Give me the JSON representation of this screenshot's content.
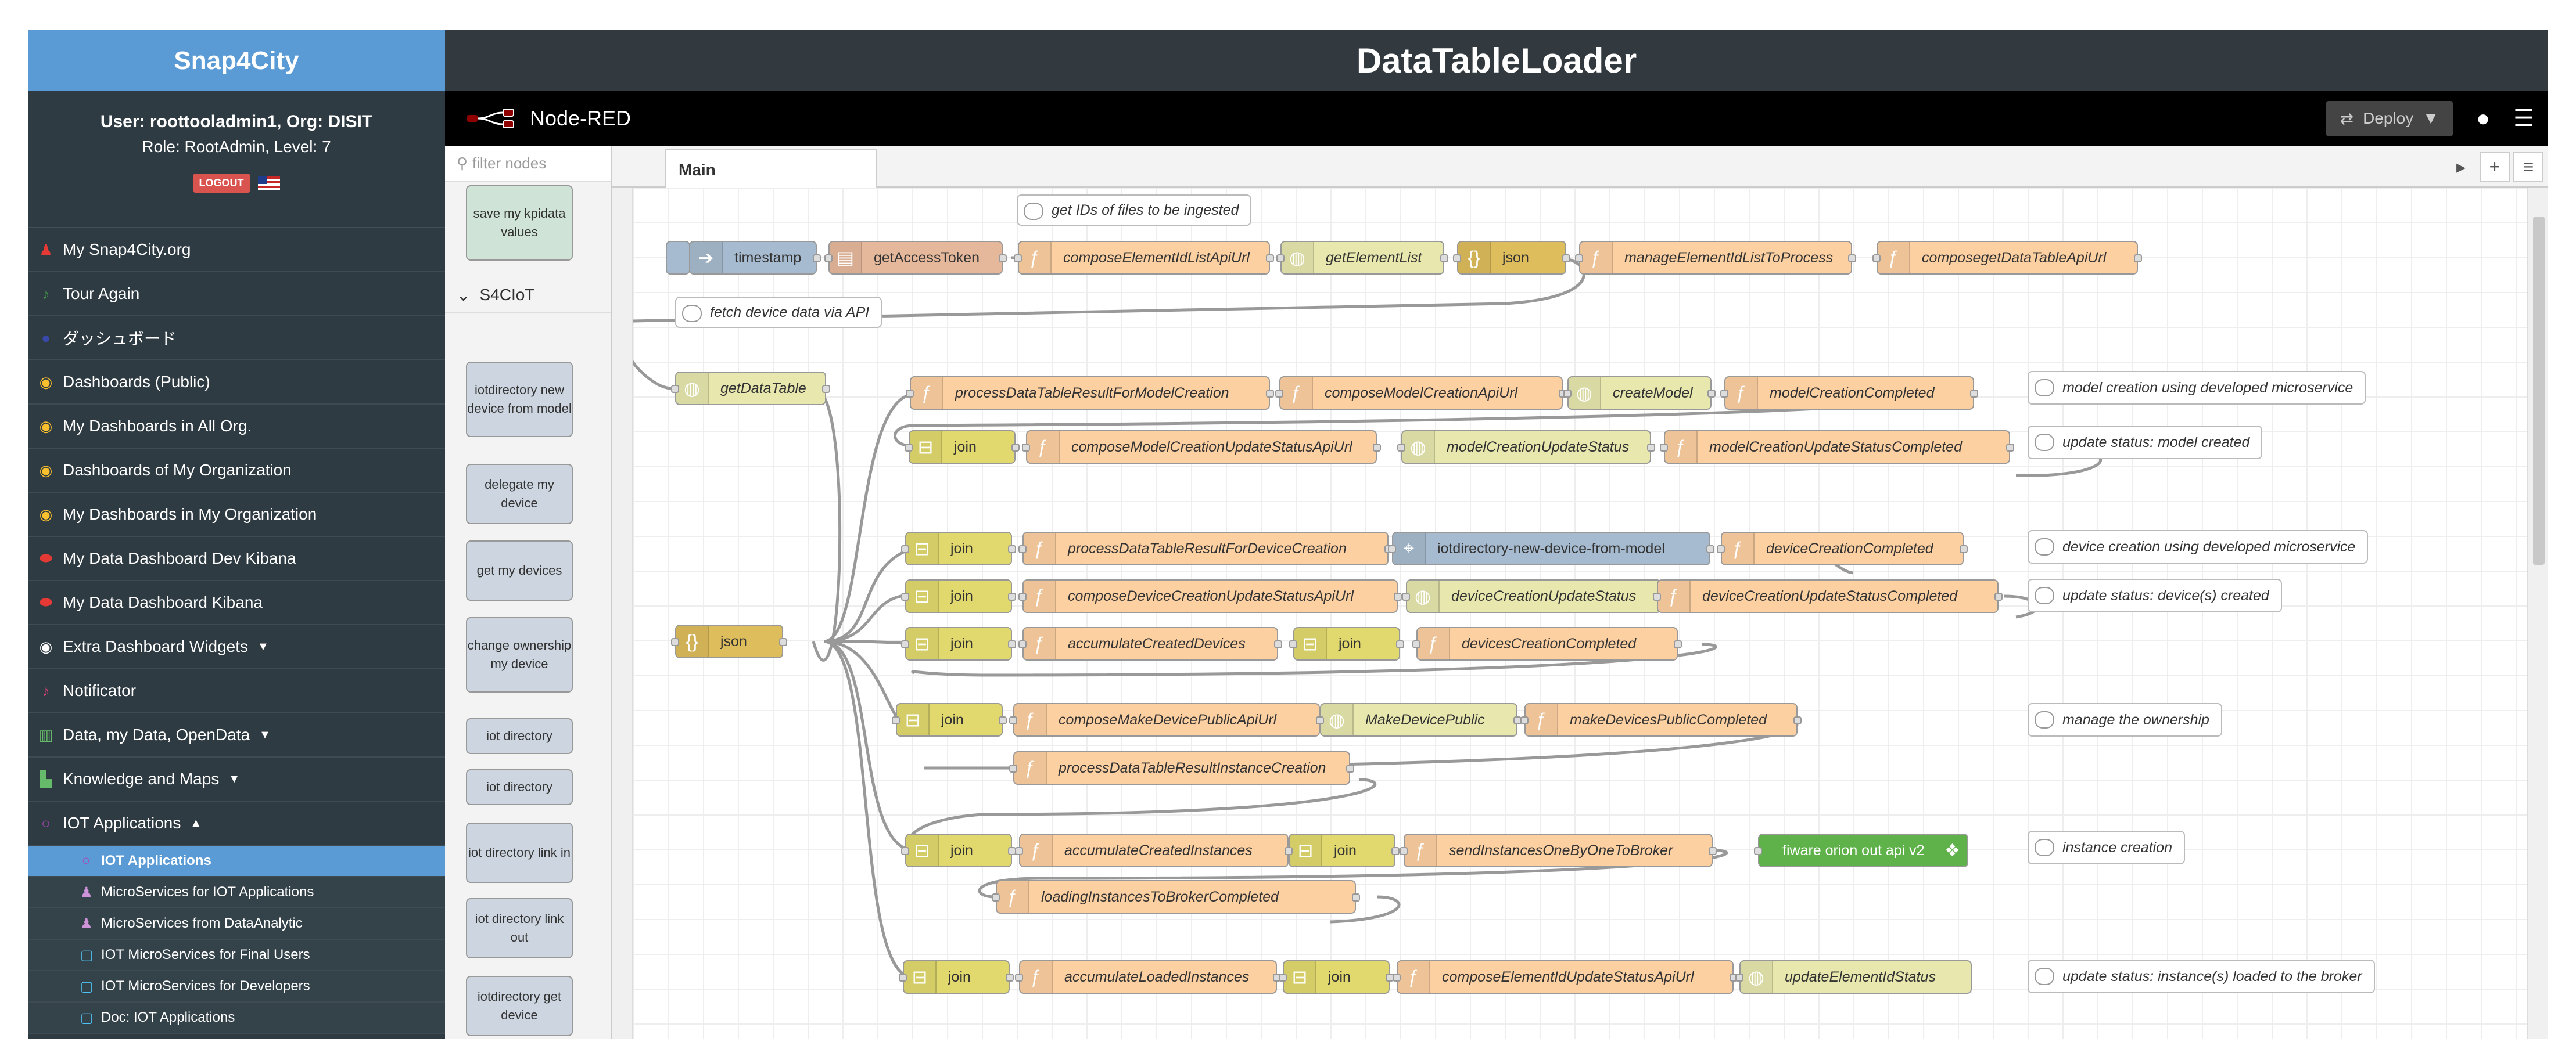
{
  "snap4city": {
    "title": "Snap4City",
    "user_line": "User: roottooladmin1, Org: DISIT",
    "role_line": "Role: RootAdmin, Level: 7",
    "logout_label": "LOGOUT",
    "menu": [
      {
        "label": "My Snap4City.org",
        "icon": "user-icon",
        "color": "#e53935"
      },
      {
        "label": "Tour Again",
        "icon": "bell-icon",
        "color": "#43a047"
      },
      {
        "label": "ダッシュボード",
        "icon": "circle-icon",
        "color": "#3949ab"
      },
      {
        "label": "Dashboards (Public)",
        "icon": "dashboard-icon",
        "color": "#fbc02d"
      },
      {
        "label": "My Dashboards in All Org.",
        "icon": "dashboard-icon",
        "color": "#fbc02d"
      },
      {
        "label": "Dashboards of My Organization",
        "icon": "dashboard-icon",
        "color": "#fbc02d"
      },
      {
        "label": "My Dashboards in My Organization",
        "icon": "dashboard-icon",
        "color": "#fbc02d"
      },
      {
        "label": "My Data Dashboard Dev Kibana",
        "icon": "database-icon",
        "color": "#e53935"
      },
      {
        "label": "My Data Dashboard Kibana",
        "icon": "database-icon",
        "color": "#e53935"
      },
      {
        "label": "Extra Dashboard Widgets",
        "icon": "dashboard-icon",
        "color": "#ffffff",
        "dropdown": "▼"
      },
      {
        "label": "Notificator",
        "icon": "bell-icon",
        "color": "#ec407a"
      },
      {
        "label": "Data, my Data, OpenData",
        "icon": "columns-icon",
        "color": "#66bb6a",
        "dropdown": "▼"
      },
      {
        "label": "Knowledge and Maps",
        "icon": "map-icon",
        "color": "#66bb6a",
        "dropdown": "▼"
      },
      {
        "label": "IOT Applications",
        "icon": "circle-outline-icon",
        "color": "#ab47bc",
        "dropdown": "▲"
      }
    ],
    "submenu": [
      {
        "label": "IOT Applications",
        "icon": "circle-outline-icon",
        "color": "#ab47bc",
        "active": true
      },
      {
        "label": "MicroServices for IOT Applications",
        "icon": "user-icon",
        "color": "#ce93d8"
      },
      {
        "label": "MicroServices from DataAnalytic",
        "icon": "user-icon",
        "color": "#ce93d8"
      },
      {
        "label": "IOT MicroServices for Final Users",
        "icon": "square-icon",
        "color": "#4fc3f7"
      },
      {
        "label": "IOT MicroServices for Developers",
        "icon": "square-icon",
        "color": "#4fc3f7"
      },
      {
        "label": "Doc: IOT Applications",
        "icon": "square-icon",
        "color": "#4fc3f7"
      }
    ]
  },
  "page_title": "DataTableLoader",
  "nodered": {
    "brand": "Node-RED",
    "deploy_label": "Deploy",
    "filter_placeholder": "filter nodes",
    "tab_main": "Main"
  },
  "palette": {
    "category": "S4CIoT",
    "nodes": [
      {
        "label": "save my kpidata values"
      },
      {
        "label": "iotdirectory new device from model"
      },
      {
        "label": "delegate my device"
      },
      {
        "label": "get my devices"
      },
      {
        "label": "change ownership my device"
      },
      {
        "label": "iot directory"
      },
      {
        "label": "iot directory"
      },
      {
        "label": "iot directory link in"
      },
      {
        "label": "iot directory link out"
      },
      {
        "label": "iotdirectory get device"
      }
    ]
  },
  "flow": {
    "comments": [
      "get IDs of files to be ingested",
      "fetch device data via API",
      "model creation using developed microservice",
      "update status: model created",
      "device creation using developed microservice",
      "update status: device(s) created",
      "manage the ownership",
      "instance creation",
      "update status: instance(s) loaded to the broker"
    ],
    "nodes": {
      "timestamp": "timestamp",
      "getAccessToken": "getAccessToken",
      "composeElementIdListApiUrl": "composeElementIdListApiUrl",
      "getElementList": "getElementList",
      "json1": "json",
      "manageElementIdListToProcess": "manageElementIdListToProcess",
      "composegetDataTableApiUrl": "composegetDataTableApiUrl",
      "getDataTable": "getDataTable",
      "json2": "json",
      "processDataTableResultForModelCreation": "processDataTableResultForModelCreation",
      "composeModelCreationApiUrl": "composeModelCreationApiUrl",
      "createModel": "createModel",
      "modelCreationCompleted": "modelCreationCompleted",
      "join1": "join",
      "composeModelCreationUpdateStatusApiUrl": "composeModelCreationUpdateStatusApiUrl",
      "modelCreationUpdateStatus": "modelCreationUpdateStatus",
      "modelCreationUpdateStatusCompleted": "modelCreationUpdateStatusCompleted",
      "join2": "join",
      "processDataTableResultForDeviceCreation": "processDataTableResultForDeviceCreation",
      "iotdirectoryNewDevice": "iotdirectory-new-device-from-model",
      "deviceCreationCompleted": "deviceCreationCompleted",
      "join3": "join",
      "composeDeviceCreationUpdateStatusApiUrl": "composeDeviceCreationUpdateStatusApiUrl",
      "deviceCreationUpdateStatus": "deviceCreationUpdateStatus",
      "deviceCreationUpdateStatusCompleted": "deviceCreationUpdateStatusCompleted",
      "join4": "join",
      "accumulateCreatedDevices": "accumulateCreatedDevices",
      "join5": "join",
      "devicesCreationCompleted": "devicesCreationCompleted",
      "join6": "join",
      "composeMakeDevicePublicApiUrl": "composeMakeDevicePublicApiUrl",
      "MakeDevicePublic": "MakeDevicePublic",
      "makeDevicesPublicCompleted": "makeDevicesPublicCompleted",
      "processDataTableResultInstanceCreation": "processDataTableResultInstanceCreation",
      "join7": "join",
      "accumulateCreatedInstances": "accumulateCreatedInstances",
      "join8": "join",
      "sendInstancesOneByOneToBroker": "sendInstancesOneByOneToBroker",
      "fiwareOrion": "fiware orion out api v2",
      "loadingInstancesToBrokerCompleted": "loadingInstancesToBrokerCompleted",
      "join9": "join",
      "accumulateLoadedInstances": "accumulateLoadedInstances",
      "join10": "join",
      "composeElementIdUpdateStatusApiUrl": "composeElementIdUpdateStatusApiUrl",
      "updateElementIdStatus": "updateElementIdStatus"
    }
  },
  "colors": {
    "function": "#fdd0a2",
    "http": "#e7e7ae",
    "json": "#debd5c",
    "join": "#e2d96e",
    "inject": "#a6bbcf",
    "fiware": "#5fb14a",
    "header_blue": "#5b9bd5"
  }
}
